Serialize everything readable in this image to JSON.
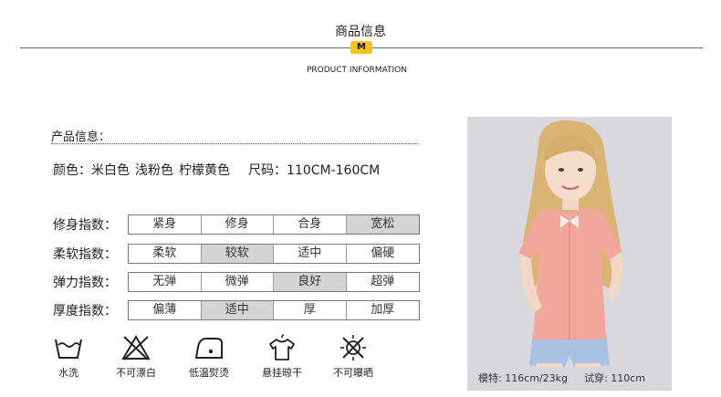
{
  "header": {
    "title": "商品信息",
    "badge": "M",
    "subtitle": "PRODUCT INFORMATION"
  },
  "product_info": {
    "heading": "产品信息：",
    "colors_label": "颜色：",
    "colors": [
      "米白色",
      "浅粉色",
      "柠檬黄色"
    ],
    "size_label": "尺码：",
    "size_range": "110CM-160CM"
  },
  "indexes": [
    {
      "label": "修身指数：",
      "options": [
        "紧身",
        "修身",
        "合身",
        "宽松"
      ],
      "selected": 3
    },
    {
      "label": "柔软指数：",
      "options": [
        "柔软",
        "较软",
        "适中",
        "偏硬"
      ],
      "selected": 1
    },
    {
      "label": "弹力指数：",
      "options": [
        "无弹",
        "微弹",
        "良好",
        "超弹"
      ],
      "selected": 2
    },
    {
      "label": "厚度指数：",
      "options": [
        "偏薄",
        "适中",
        "厚",
        "加厚"
      ],
      "selected": 1
    }
  ],
  "care_icons": [
    {
      "icon": "hand-wash-icon",
      "label": "水洗"
    },
    {
      "icon": "no-bleach-icon",
      "label": "不可漂白"
    },
    {
      "icon": "low-iron-icon",
      "label": "低温熨烫"
    },
    {
      "icon": "hang-dry-icon",
      "label": "悬挂晾干"
    },
    {
      "icon": "no-sun-dry-icon",
      "label": "不可曝晒"
    }
  ],
  "model": {
    "stats": "模特: 116cm/23kg",
    "fit": "试穿: 110cm"
  },
  "colors": {
    "accent": "#f0c418",
    "selected_cell": "#d4d4d4",
    "photo_bg": "#d9d8dd",
    "shirt": "#f1a79c",
    "shorts": "#a9c2e4"
  }
}
